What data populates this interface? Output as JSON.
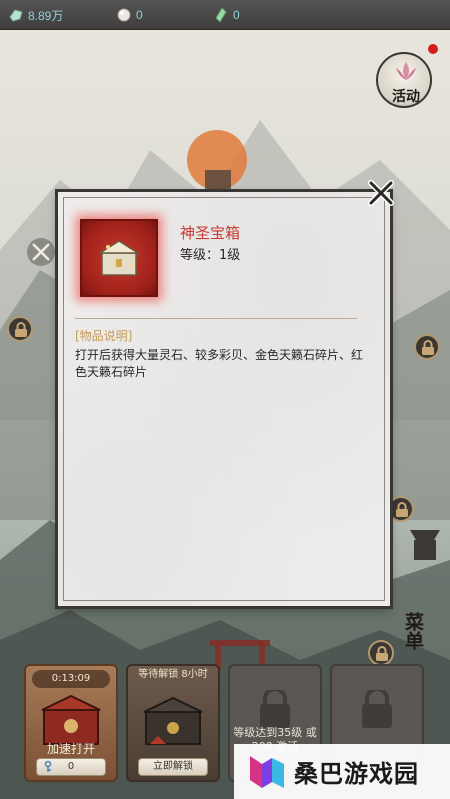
{
  "topbar": {
    "resources": [
      {
        "icon": "spirit-stone-icon",
        "value": "8.89万"
      },
      {
        "icon": "pearl-icon",
        "value": "0"
      },
      {
        "icon": "jade-icon",
        "value": "0"
      }
    ]
  },
  "side": {
    "activity_label": "活动",
    "menu_label": "菜单"
  },
  "modal": {
    "item_name": "神圣宝箱",
    "item_level": "等级：1级",
    "desc_title": "[物品说明]",
    "desc_text": "打开后获得大量灵石、较多彩贝、金色天籁石碎片、红色天籁石碎片"
  },
  "slots": [
    {
      "timer": "0:13:09",
      "caption": "加速打开",
      "button": "0"
    },
    {
      "status": "等待解锁 8小时",
      "button": "立即解锁"
    },
    {
      "caption": "等级达到35级 或200 激活"
    },
    {}
  ],
  "watermark": {
    "text": "桑巴游戏园"
  },
  "colors": {
    "item_name": "#c83a33",
    "resource_value": "#8fd3d6",
    "desc_title": "#c59a59"
  }
}
